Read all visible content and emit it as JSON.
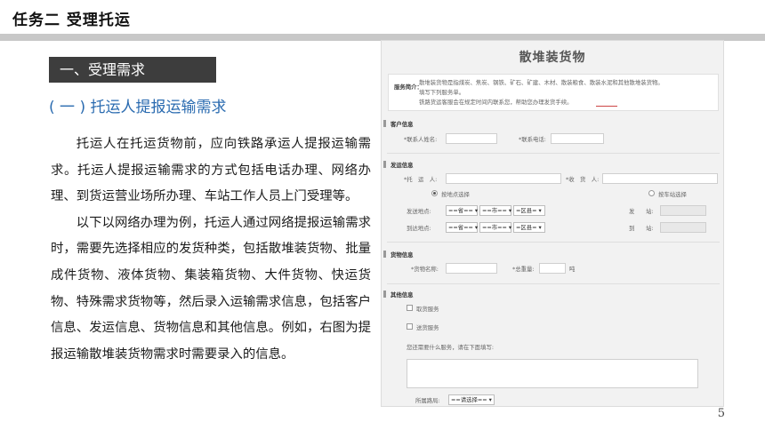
{
  "header": {
    "title": "任务二  受理托运"
  },
  "section": {
    "tag": "一、受理需求",
    "subheading": "( 一 ) 托运人提报运输需求"
  },
  "body": {
    "paragraphs": [
      "托运人在托运货物前，应向铁路承运人提报运输需求。托运人提报运输需求的方式包括电话办理、网络办理、到货运营业场所办理、车站工作人员上门受理等。",
      "以下以网络办理为例，托运人通过网络提报运输需求时，需要先选择相应的发货种类，包括散堆装货物、批量成件货物、液体货物、集装箱货物、大件货物、快运货物、特殊需求货物等，然后录入运输需求信息，包括客户信息、发运信息、货物信息和其他信息。例如，右图为提报运输散堆装货物需求时需要录入的信息。"
    ]
  },
  "page_number": "5",
  "form": {
    "title": "散堆装货物",
    "notice": {
      "label": "服务简介：",
      "lines": [
        "散堆装货物是指煤炭、焦炭、钢铁、矿石、矿建、木材、散装粮食、散装水泥和其他散堆装货物。",
        "填写下列服务单。",
        "铁路货运客服会在规定时间内联系您，帮助您办理发货手续。"
      ]
    },
    "customer": {
      "title": "客户信息",
      "contact_name_label": "*联系人姓名:",
      "contact_phone_label": "*联系电话:"
    },
    "shipping": {
      "title": "发运信息",
      "shipper_label": "*托　运　人:",
      "consignee_label": "*收　货　人:",
      "radio_location": "按地点选择",
      "radio_station": "按车站选择",
      "origin_label": "发送地点:",
      "dest_label": "到达地点:",
      "province_option": "==省==",
      "city_option": "==市==",
      "district_option": "=区县=",
      "send_station_label": "发　　站:",
      "arrive_station_label": "到　　站:"
    },
    "cargo": {
      "title": "货物信息",
      "name_label": "*货物名称:",
      "weight_label": "*总重量:",
      "unit": "吨"
    },
    "other": {
      "title": "其他信息",
      "pickup_label": "取货服务",
      "delivery_label": "送货服务",
      "needs_prompt": "您还需要什么服务，请在下面填写:",
      "bureau_label": "所属路局:",
      "bureau_option": "==请选择=="
    }
  }
}
